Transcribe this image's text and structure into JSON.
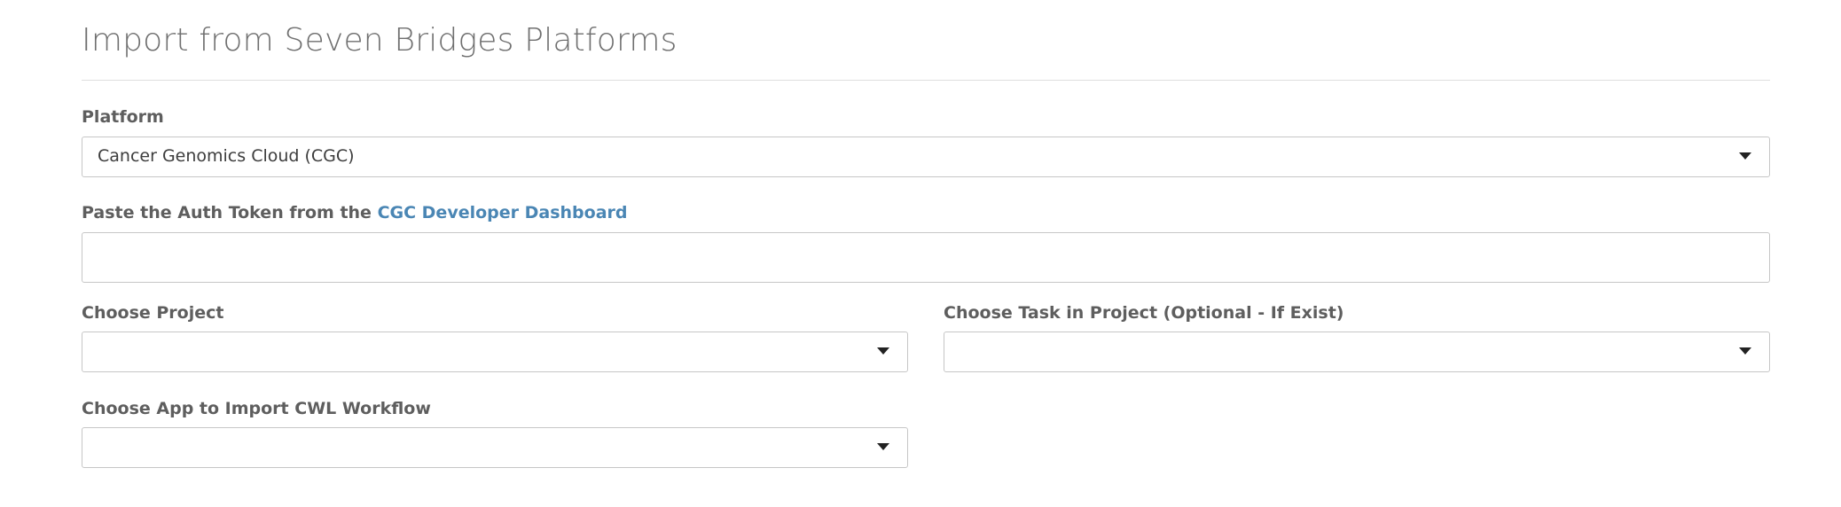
{
  "page": {
    "title": "Import from Seven Bridges Platforms"
  },
  "platform": {
    "label": "Platform",
    "selected": "Cancer Genomics Cloud (CGC)"
  },
  "auth_token": {
    "label_prefix": "Paste the Auth Token from the ",
    "link_text": "CGC Developer Dashboard",
    "value": "",
    "placeholder": ""
  },
  "project": {
    "label": "Choose Project",
    "selected": ""
  },
  "task": {
    "label": "Choose Task in Project (Optional - If Exist)",
    "selected": ""
  },
  "app": {
    "label": "Choose App to Import CWL Workflow",
    "selected": ""
  },
  "colors": {
    "link": "#4a86b4",
    "label": "#5e5e5e",
    "title": "#6f6f6f",
    "border": "#c6c6c6"
  },
  "icons": {
    "dropdown": "caret-down-icon"
  }
}
